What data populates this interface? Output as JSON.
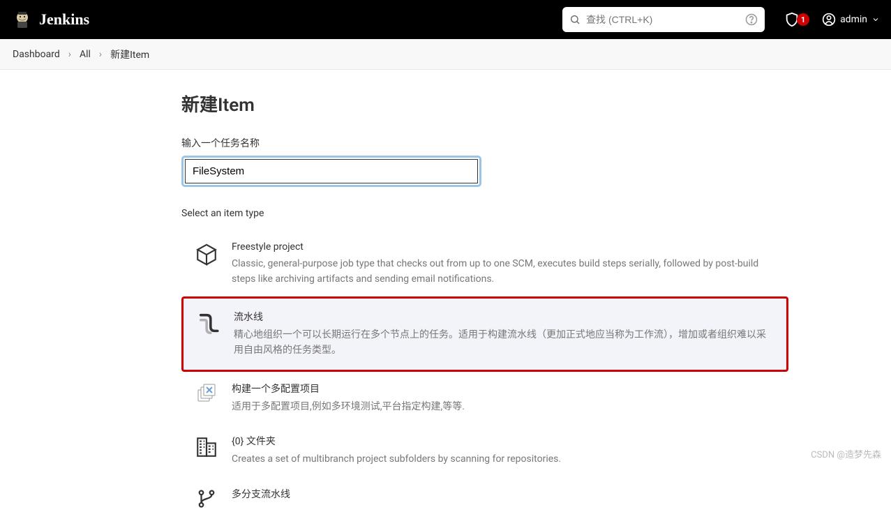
{
  "header": {
    "logo_text": "Jenkins",
    "search_placeholder": "查找 (CTRL+K)",
    "alert_count": "1",
    "user_name": "admin"
  },
  "breadcrumb": {
    "items": [
      "Dashboard",
      "All",
      "新建Item"
    ]
  },
  "page": {
    "title": "新建Item",
    "name_label": "输入一个任务名称",
    "name_value": "FileSystem",
    "section_label": "Select an item type"
  },
  "item_types": [
    {
      "title": "Freestyle project",
      "desc": "Classic, general-purpose job type that checks out from up to one SCM, executes build steps serially, followed by post-build steps like archiving artifacts and sending email notifications.",
      "selected": false,
      "icon": "cube"
    },
    {
      "title": "流水线",
      "desc": "精心地组织一个可以长期运行在多个节点上的任务。适用于构建流水线（更加正式地应当称为工作流），增加或者组织难以采用自由风格的任务类型。",
      "selected": true,
      "icon": "pipe"
    },
    {
      "title": "构建一个多配置项目",
      "desc": "适用于多配置项目,例如多环境测试,平台指定构建,等等.",
      "selected": false,
      "icon": "multiconfig"
    },
    {
      "title": "{0} 文件夹",
      "desc": "Creates a set of multibranch project subfolders by scanning for repositories.",
      "selected": false,
      "icon": "building"
    },
    {
      "title": "多分支流水线",
      "desc": "",
      "selected": false,
      "icon": "branches"
    }
  ],
  "watermark": "CSDN @造梦先森"
}
